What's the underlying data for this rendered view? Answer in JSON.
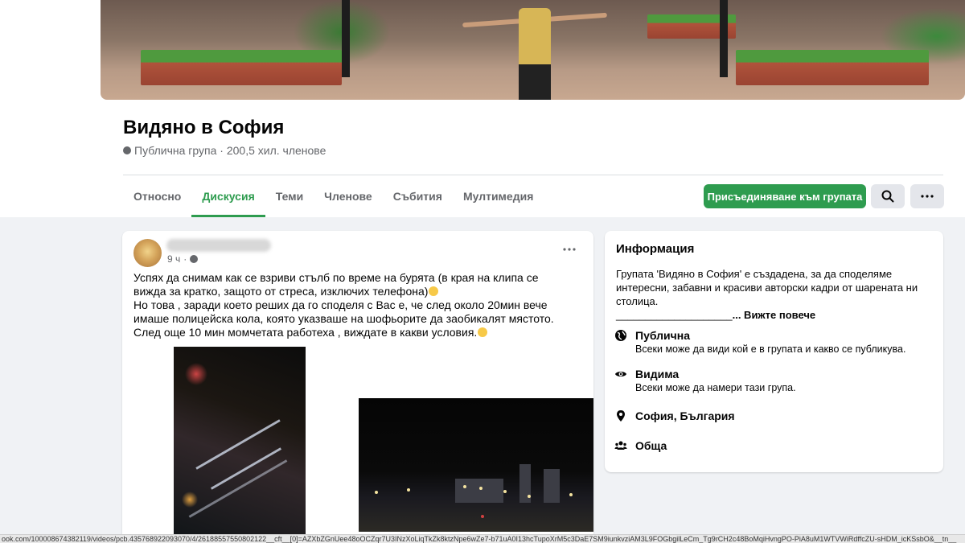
{
  "group": {
    "name": "Видяно в София",
    "meta": "Публична група · 200,5 хил. членове"
  },
  "tabs": [
    {
      "label": "Относно"
    },
    {
      "label": "Дискусия",
      "active": true
    },
    {
      "label": "Теми"
    },
    {
      "label": "Членове"
    },
    {
      "label": "Събития"
    },
    {
      "label": "Мултимедия"
    }
  ],
  "actions": {
    "join_label": "Присъединяване към групата",
    "search_icon": "search-icon",
    "more_icon": "more-icon"
  },
  "post": {
    "time": "9 ч",
    "text_line1": "Успях да снимам как се взриви стълб по време на бурята  (в края на клипа се вижда за кратко, защото от стреса, изключих телефона)",
    "text_line2": "Но  това , заради което реших да го споделя с Вас е, че след около 20мин вече имаше полицейска кола, която указваше на шофьорите да заобикалят мястото. След още 10 мин момчетата работеха , виждате в какви условия."
  },
  "info": {
    "heading": "Информация",
    "description": "Групата 'Видяно в София' е създадена, за да споделяме интересни, забавни и красиви авторски кадри от шарената ни столица.",
    "underline": "____________________",
    "see_more": "... Вижте повече",
    "rows": [
      {
        "icon": "globe-icon",
        "title": "Публична",
        "sub": "Всеки може да види кой е в групата и какво се публикува."
      },
      {
        "icon": "eye-icon",
        "title": "Видима",
        "sub": "Всеки може да намери тази група."
      },
      {
        "icon": "location-pin-icon",
        "title": "София, България",
        "sub": ""
      },
      {
        "icon": "people-icon",
        "title": "Обща",
        "sub": ""
      }
    ]
  },
  "status_bar": "ook.com/100008674382119/videos/pcb.435768922093070/4/26188557550802122__cft__[0]=AZXbZGnUee48oOCZqr7U3INzXoLiqTkZk8ktzNpe6wZe7-b71uA0I13hcTupoXrM5c3DaE7SM9iunkvziAM3L9FOGbgilLeCm_Tg9rCH2c48BoMqiHvngPO-PiA8uM1WTVWiRdffcZU-sHDM_icKSsbO&__tn__"
}
